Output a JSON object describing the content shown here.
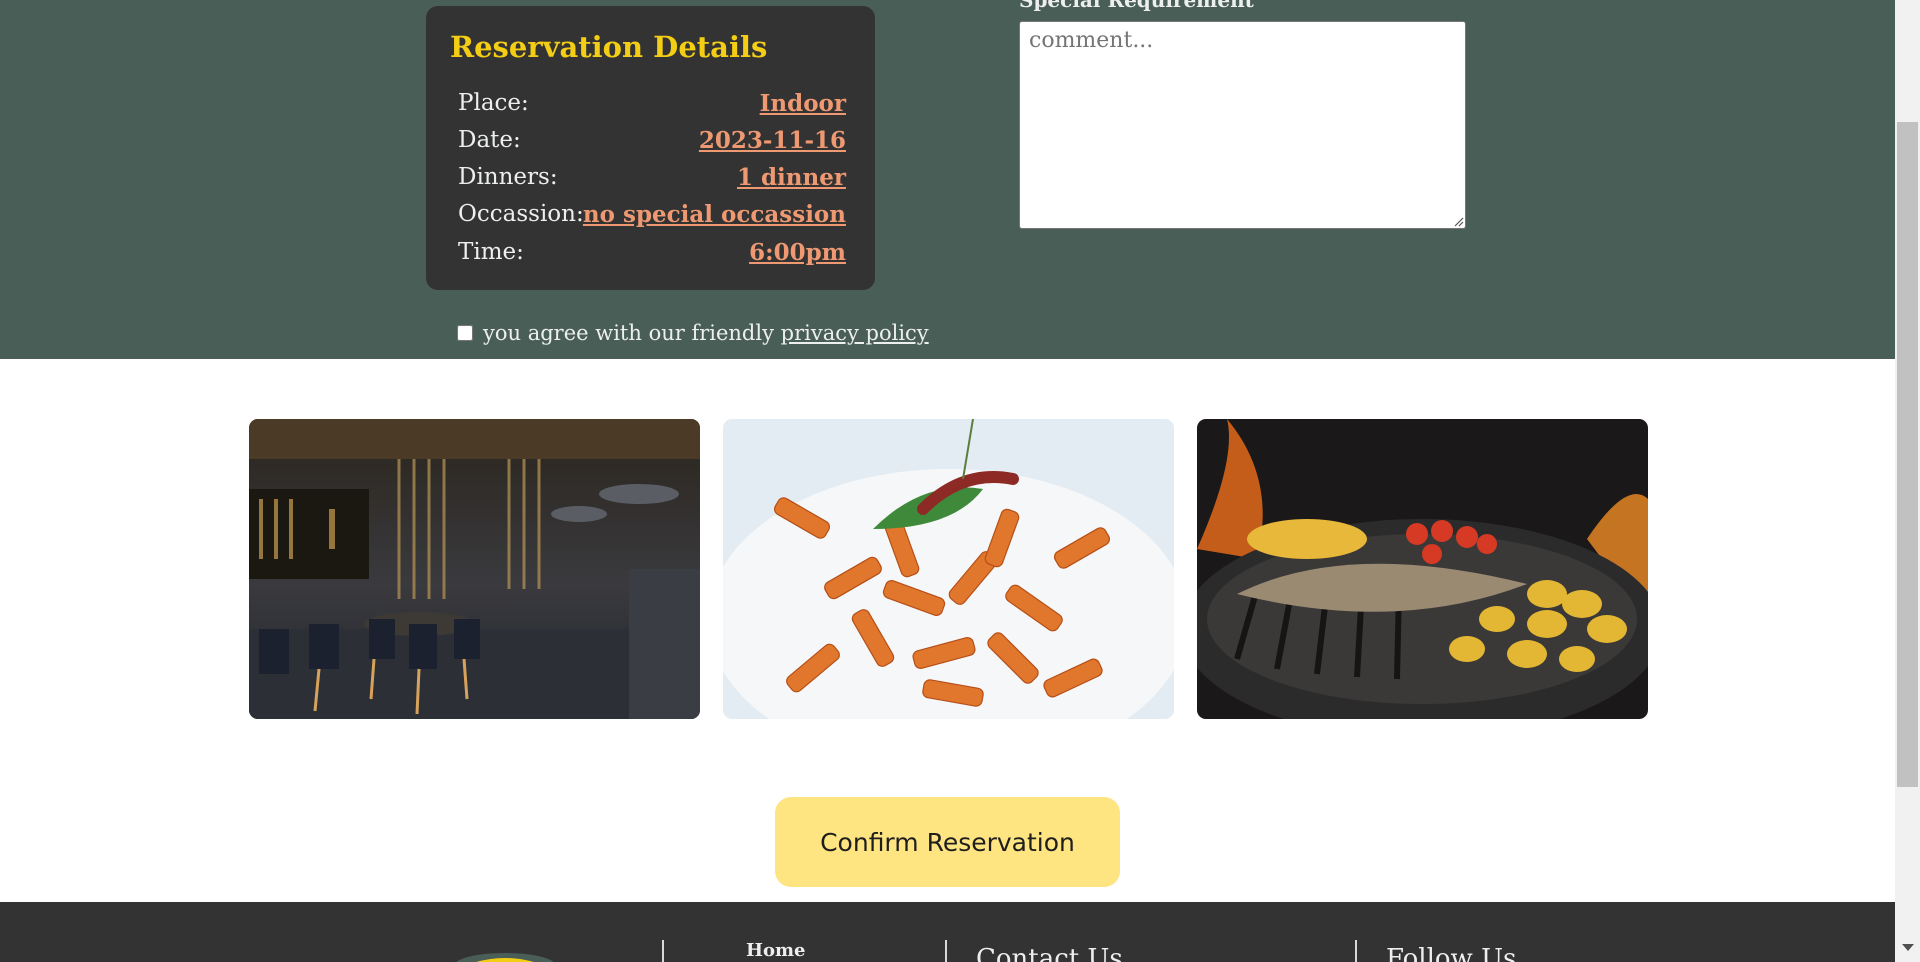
{
  "form": {
    "special_requirement_label": "Special Requirement",
    "comment_placeholder": "comment...",
    "comment_value": ""
  },
  "reservation": {
    "title": "Reservation Details",
    "rows": [
      {
        "label": "Place:",
        "value": "Indoor"
      },
      {
        "label": "Date:",
        "value": "2023-11-16"
      },
      {
        "label": "Dinners:",
        "value": "1 dinner"
      },
      {
        "label": "Occassion:",
        "value": "no special occassion"
      },
      {
        "label": "Time:",
        "value": "6:00pm"
      }
    ]
  },
  "privacy": {
    "text": "you agree with our friendly ",
    "link": "privacy policy",
    "checked": false
  },
  "gallery": {
    "images": [
      "restaurant-interior",
      "penne-pasta",
      "grilled-fish"
    ]
  },
  "confirm_button": "Confirm Reservation",
  "footer": {
    "nav_home": "Home",
    "contact_heading": "Contact Us",
    "follow_heading": "Follow Us"
  },
  "colors": {
    "primary_green": "#495e57",
    "yellow": "#f4ce14",
    "salmon": "#ee9972",
    "dark": "#333333",
    "button_yellow": "#fee581"
  }
}
